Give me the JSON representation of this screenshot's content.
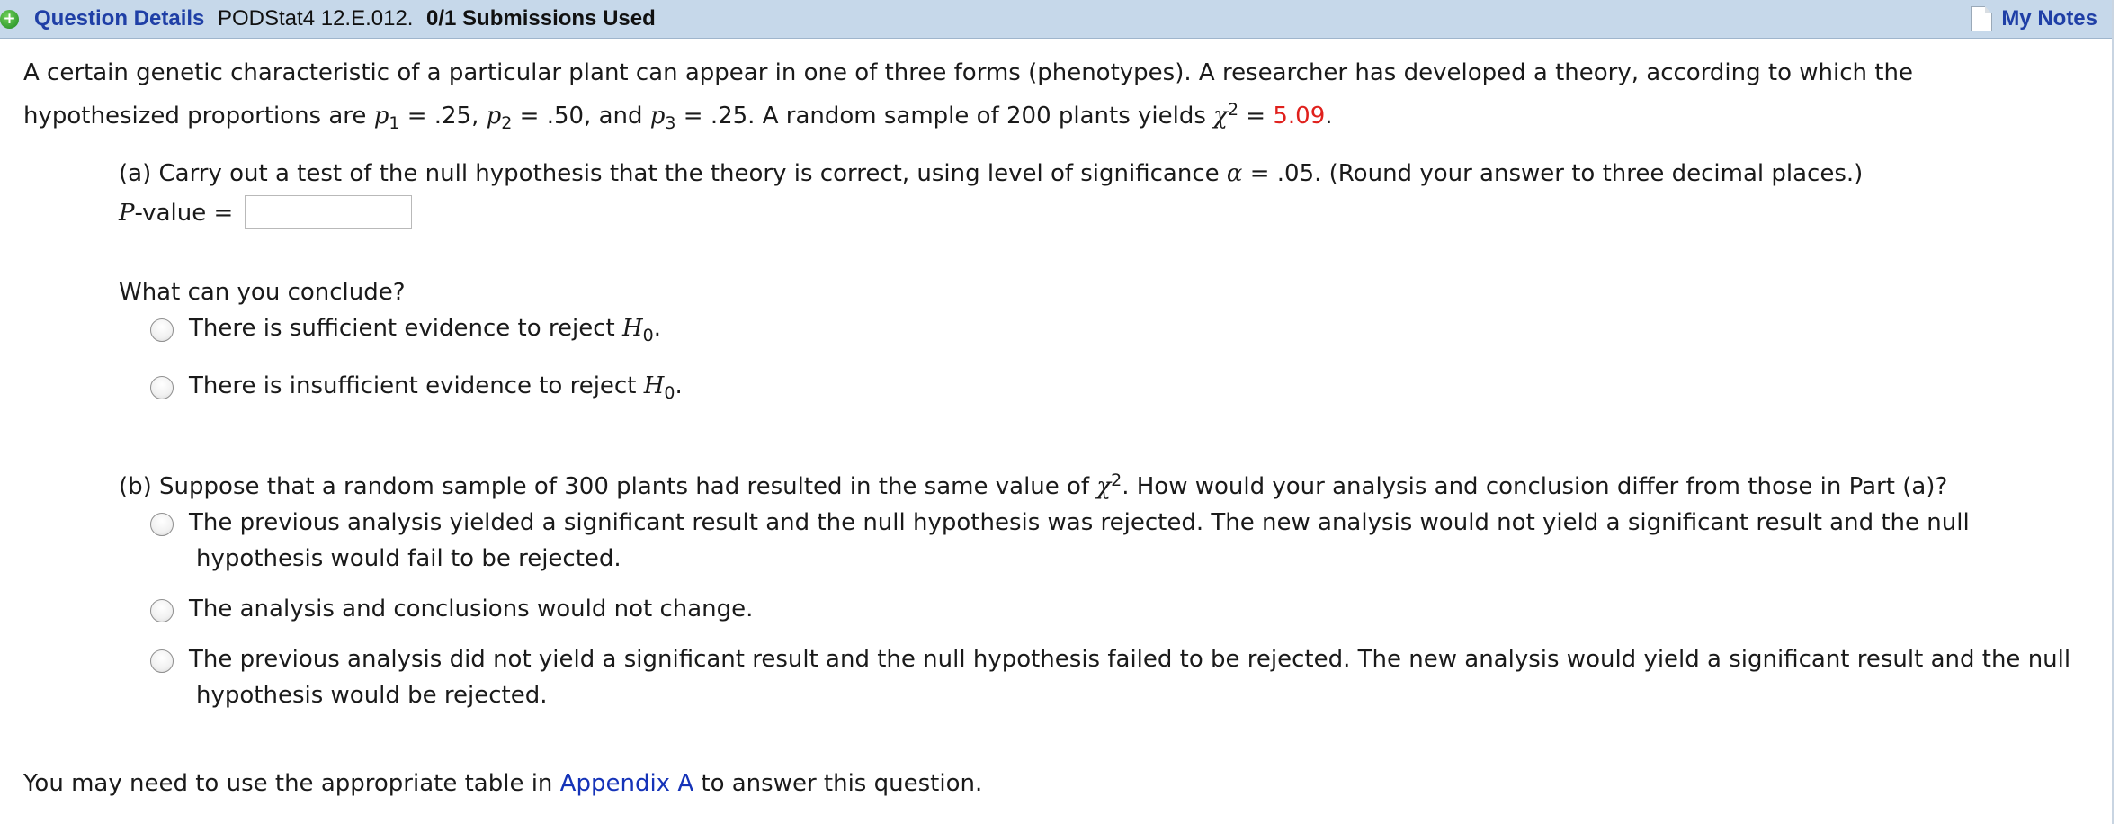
{
  "header": {
    "question_details_label": "Question Details",
    "question_id": "PODStat4 12.E.012.",
    "submissions": "0/1 Submissions Used",
    "my_notes_label": "My Notes"
  },
  "problem": {
    "intro_line1": "A certain genetic characteristic of a particular plant can appear in one of three forms (phenotypes). A researcher has developed a theory, according to which the",
    "intro_line2_prefix": "hypothesized proportions are",
    "p1_var": "p",
    "p1_sub": "1",
    "p1_val": " = .25,",
    "p2_var": "p",
    "p2_sub": "2",
    "p2_val": " = .50, and",
    "p3_var": "p",
    "p3_sub": "3",
    "p3_val": " = .25. A random sample of 200 plants yields",
    "chi_var": "χ",
    "chi_sup": "2",
    "chi_eq": " = ",
    "chi_value": "5.09",
    "period": "."
  },
  "part_a": {
    "instruction_prefix": "(a) Carry out a test of the null hypothesis that the theory is correct, using level of significance",
    "alpha_var": "α",
    "instruction_suffix": " = .05. (Round your answer to three decimal places.)",
    "pvalue_var": "P",
    "pvalue_suffix": "-value =",
    "pvalue_input": "",
    "conclude_prompt": "What can you conclude?",
    "options": [
      {
        "text": "There is sufficient evidence to reject",
        "h": "H",
        "h_sub": "0",
        "end": "."
      },
      {
        "text": "There is insufficient evidence to reject",
        "h": "H",
        "h_sub": "0",
        "end": "."
      }
    ]
  },
  "part_b": {
    "prompt_prefix": "(b) Suppose that a random sample of 300 plants had resulted in the same value of",
    "chi_var": "χ",
    "chi_sup": "2",
    "prompt_suffix": ". How would your analysis and conclusion differ from those in Part (a)?",
    "options": [
      {
        "line1": "The previous analysis yielded a significant result and the null hypothesis was rejected. The new analysis would not yield a significant result and the null",
        "line2": "hypothesis would fail to be rejected."
      },
      {
        "line1": "The analysis and conclusions would not change.",
        "line2": ""
      },
      {
        "line1": "The previous analysis did not yield a significant result and the null hypothesis failed to be rejected. The new analysis would yield a significant result and the null",
        "line2": "hypothesis would be rejected."
      }
    ]
  },
  "footer": {
    "prefix": "You may need to use the appropriate table in",
    "link": "Appendix A",
    "suffix": "to answer this question."
  }
}
